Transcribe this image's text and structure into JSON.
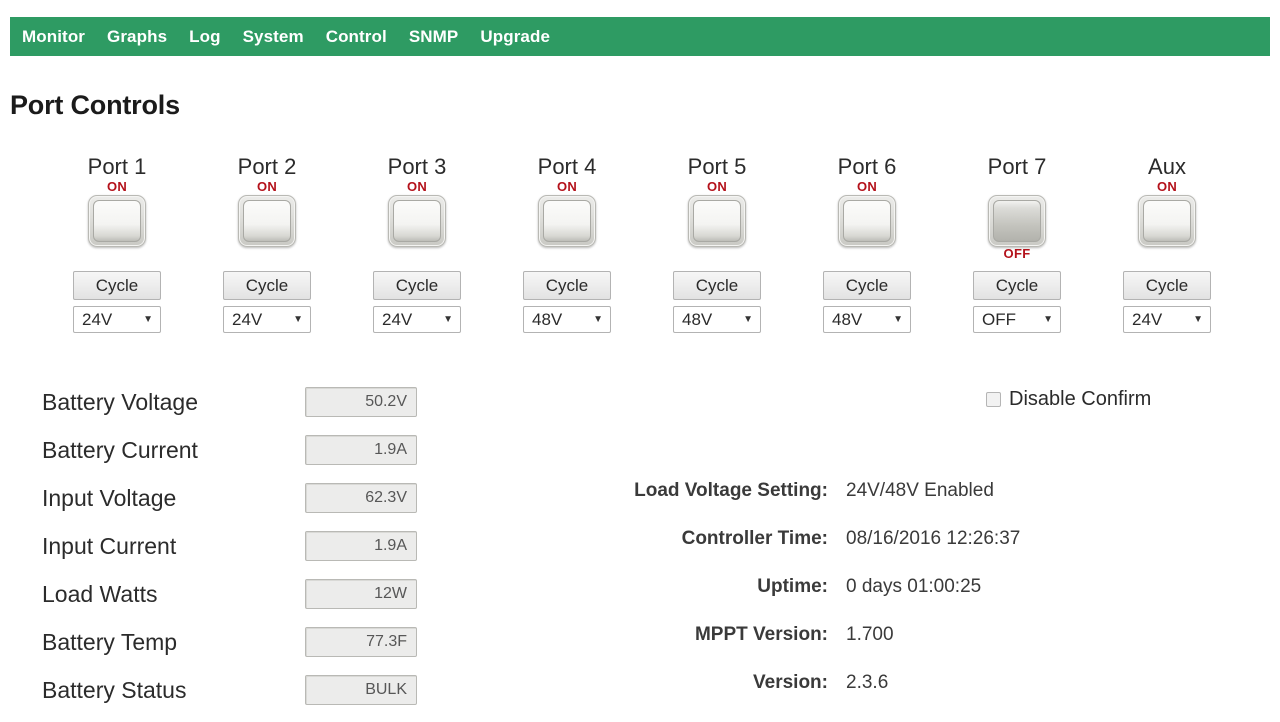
{
  "nav": {
    "items": [
      {
        "label": "Monitor"
      },
      {
        "label": "Graphs"
      },
      {
        "label": "Log"
      },
      {
        "label": "System"
      },
      {
        "label": "Control"
      },
      {
        "label": "SNMP"
      },
      {
        "label": "Upgrade"
      }
    ],
    "background_color": "#2e9b63"
  },
  "page": {
    "title": "Port Controls"
  },
  "ports": {
    "cycle_label": "Cycle",
    "dropdown_arrow": "▼",
    "items": [
      {
        "name": "Port 1",
        "state": "ON",
        "state_position": "above",
        "voltage": "24V"
      },
      {
        "name": "Port 2",
        "state": "ON",
        "state_position": "above",
        "voltage": "24V"
      },
      {
        "name": "Port 3",
        "state": "ON",
        "state_position": "above",
        "voltage": "24V"
      },
      {
        "name": "Port 4",
        "state": "ON",
        "state_position": "above",
        "voltage": "48V"
      },
      {
        "name": "Port 5",
        "state": "ON",
        "state_position": "above",
        "voltage": "48V"
      },
      {
        "name": "Port 6",
        "state": "ON",
        "state_position": "above",
        "voltage": "48V"
      },
      {
        "name": "Port 7",
        "state": "OFF",
        "state_position": "below",
        "voltage": "OFF"
      },
      {
        "name": "Aux",
        "state": "ON",
        "state_position": "above",
        "voltage": "24V"
      }
    ],
    "state_color": "#b4121b"
  },
  "readouts": [
    {
      "label": "Battery Voltage",
      "value": "50.2V"
    },
    {
      "label": "Battery Current",
      "value": "1.9A"
    },
    {
      "label": "Input Voltage",
      "value": "62.3V"
    },
    {
      "label": "Input Current",
      "value": "1.9A"
    },
    {
      "label": "Load Watts",
      "value": "12W"
    },
    {
      "label": "Battery Temp",
      "value": "77.3F"
    },
    {
      "label": "Battery Status",
      "value": "BULK"
    }
  ],
  "disable_confirm": {
    "label": "Disable Confirm",
    "checked": false
  },
  "info": [
    {
      "label": "Load Voltage Setting:",
      "value": "24V/48V Enabled"
    },
    {
      "label": "Controller Time:",
      "value": "08/16/2016 12:26:37"
    },
    {
      "label": "Uptime:",
      "value": "0 days 01:00:25"
    },
    {
      "label": "MPPT Version:",
      "value": "1.700"
    },
    {
      "label": "Version:",
      "value": "2.3.6"
    }
  ]
}
